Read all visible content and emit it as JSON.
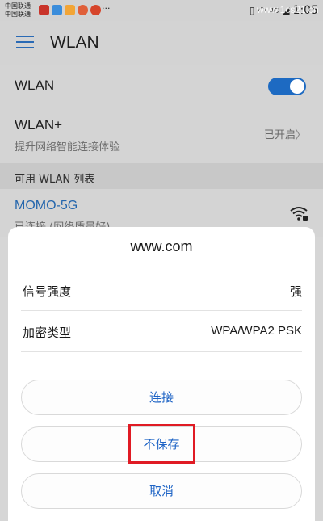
{
  "status_bar": {
    "carrier_1": "中国联通",
    "carrier_2": "中国联通",
    "dots": "···",
    "network_type": "4G",
    "time": "1:05",
    "watermark": "www.1cs21.cn"
  },
  "header": {
    "title": "WLAN"
  },
  "settings": {
    "wlan_label": "WLAN",
    "wlan_toggle_on": true,
    "wlan_plus_label": "WLAN+",
    "wlan_plus_subtitle": "提升网络智能连接体验",
    "wlan_plus_status": "已开启",
    "section_title": "可用 WLAN 列表",
    "network_name": "MOMO-5G",
    "network_status": "已连接 (网络质量好)"
  },
  "dialog": {
    "title": "www.com",
    "signal_label": "信号强度",
    "signal_value": "强",
    "security_label": "加密类型",
    "security_value": "WPA/WPA2 PSK",
    "connect_label": "连接",
    "forget_label": "不保存",
    "cancel_label": "取消"
  },
  "colors": {
    "accent": "#1d6ac2",
    "highlight": "#e01b24"
  }
}
